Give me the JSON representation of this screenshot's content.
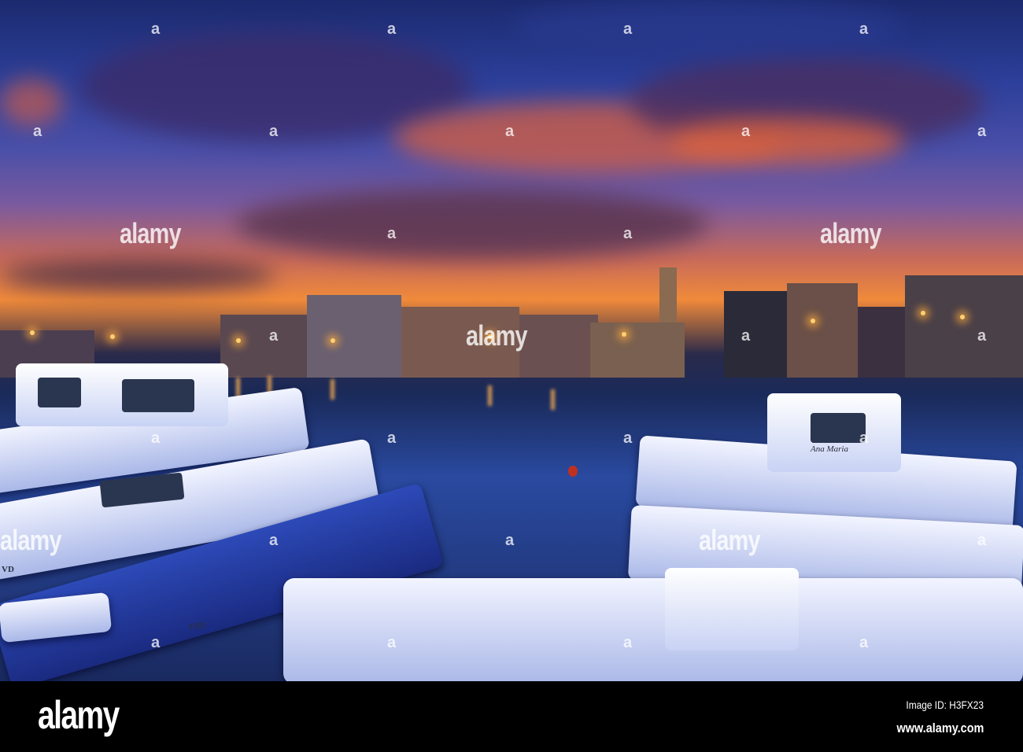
{
  "photo": {
    "boat_names": [
      "Ana Maria",
      "1931",
      "VD"
    ],
    "watermark_letter": "a",
    "watermark_word": "alamy"
  },
  "footer": {
    "logo": "alamy",
    "image_id": "Image ID: H3FX23",
    "website": "www.alamy.com"
  }
}
